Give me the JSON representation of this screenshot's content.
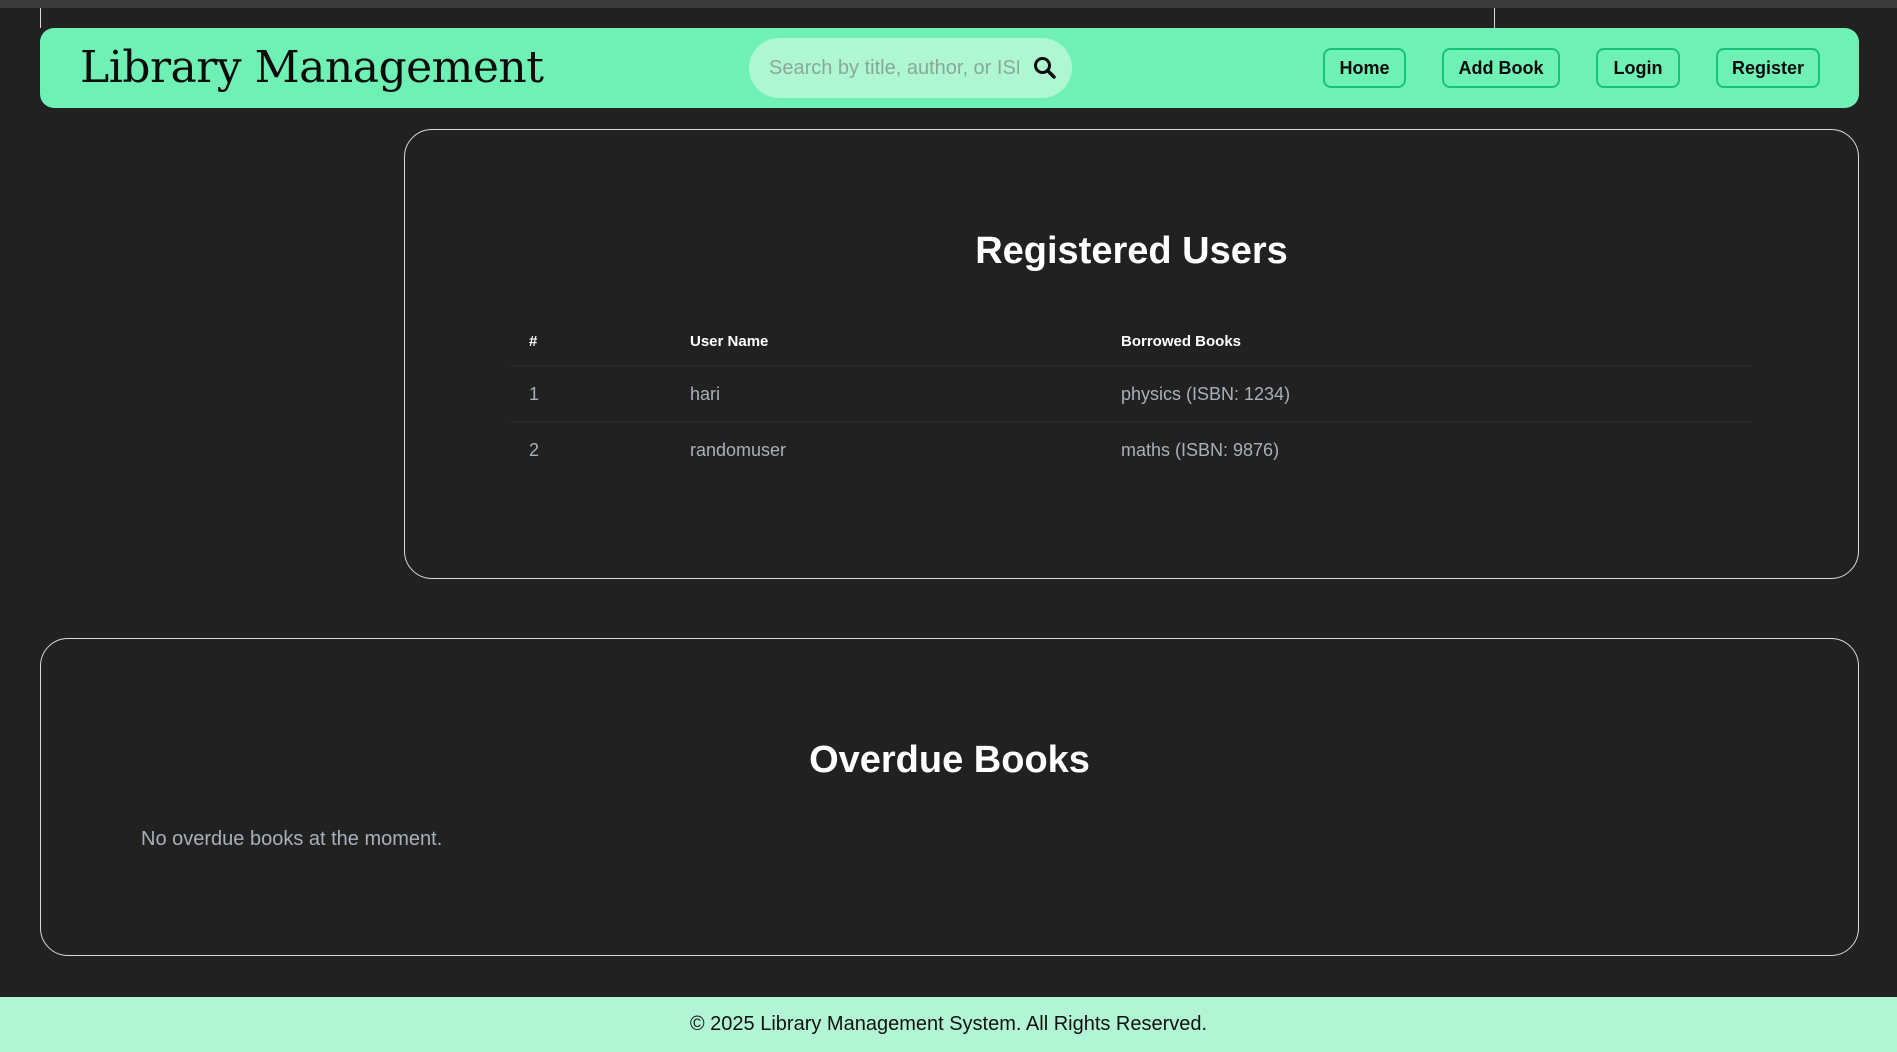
{
  "header": {
    "brand": "Library Management",
    "search": {
      "placeholder": "Search by title, author, or ISBN",
      "value": "",
      "icon": "search-icon"
    },
    "nav": {
      "home": "Home",
      "add_book": "Add Book",
      "login": "Login",
      "register": "Register"
    }
  },
  "colors": {
    "background": "#212121",
    "navbar": "#6ff0b4",
    "search_bg": "#aef7d2",
    "button_border": "#16c27e",
    "footer_bg": "#b2f5d4"
  },
  "users": {
    "title": "Registered Users",
    "columns": [
      "#",
      "User Name",
      "Borrowed Books"
    ],
    "rows": [
      [
        "1",
        "hari",
        "physics (ISBN: 1234)"
      ],
      [
        "2",
        "randomuser",
        "maths (ISBN: 9876)"
      ]
    ]
  },
  "overdue": {
    "title": "Overdue Books",
    "empty_message": "No overdue books at the moment."
  },
  "footer": {
    "text": "© 2025 Library Management System. All Rights Reserved."
  }
}
